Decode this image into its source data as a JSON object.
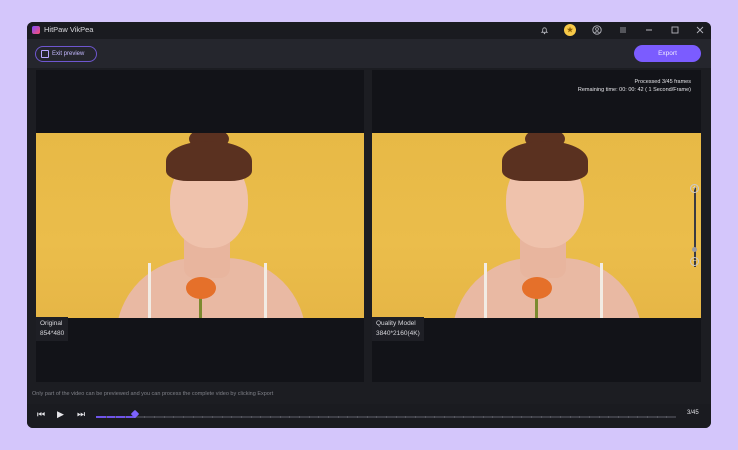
{
  "app": {
    "title": "HitPaw VikPea"
  },
  "titlebar": {
    "icons": [
      "bell-icon",
      "coin-icon",
      "user-icon",
      "menu-icon",
      "minimize-icon",
      "maximize-icon",
      "close-icon"
    ],
    "coin_label": "★"
  },
  "toolbar": {
    "exit_label": "Exit preview",
    "export_label": "Export"
  },
  "preview": {
    "status_line1": "Processed 3/45 frames",
    "status_line2": "Remaining time: 00: 00: 42 ( 1 Second/Frame)",
    "left": {
      "title": "Original",
      "resolution": "854*480"
    },
    "right": {
      "title": "Quality Model",
      "resolution": "3840*2160(4K)"
    },
    "zoom": {
      "plus": "+",
      "minus": "−"
    }
  },
  "hint": "Only part of the video can be previewed and you can process the complete video by clicking Export",
  "player": {
    "prev_label": "⏮",
    "play_label": "▶",
    "next_label": "⏭",
    "frame_counter": "3/45",
    "progress": 0.067
  },
  "colors": {
    "accent": "#7b5cff",
    "background": "#1c1d22",
    "frame": "#d4c6fb"
  }
}
